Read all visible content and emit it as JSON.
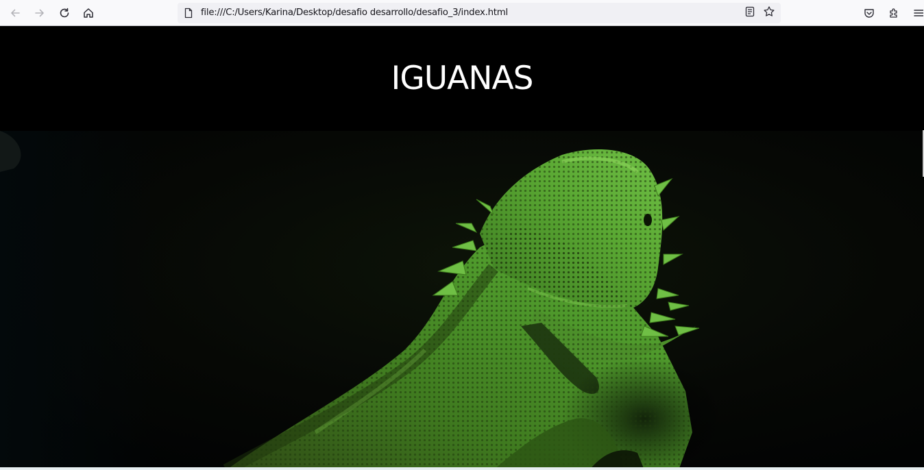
{
  "browser": {
    "url": "file:///C:/Users/Karina/Desktop/desafio desarrollo/desafio_3/index.html",
    "icons": {
      "back": "back-arrow-icon",
      "forward": "forward-arrow-icon",
      "reload": "reload-icon",
      "home": "home-icon",
      "page": "page-icon",
      "reader": "reader-view-icon",
      "bookmark": "bookmark-star-icon",
      "pocket": "pocket-icon",
      "extensions": "extensions-icon",
      "menu": "menu-icon"
    }
  },
  "page": {
    "title": "IGUANAS",
    "hero_image": "iguana-photo"
  },
  "colors": {
    "header_bg": "#000000",
    "title_color": "#ffffff",
    "lizard_green": "#4f9a2c"
  }
}
